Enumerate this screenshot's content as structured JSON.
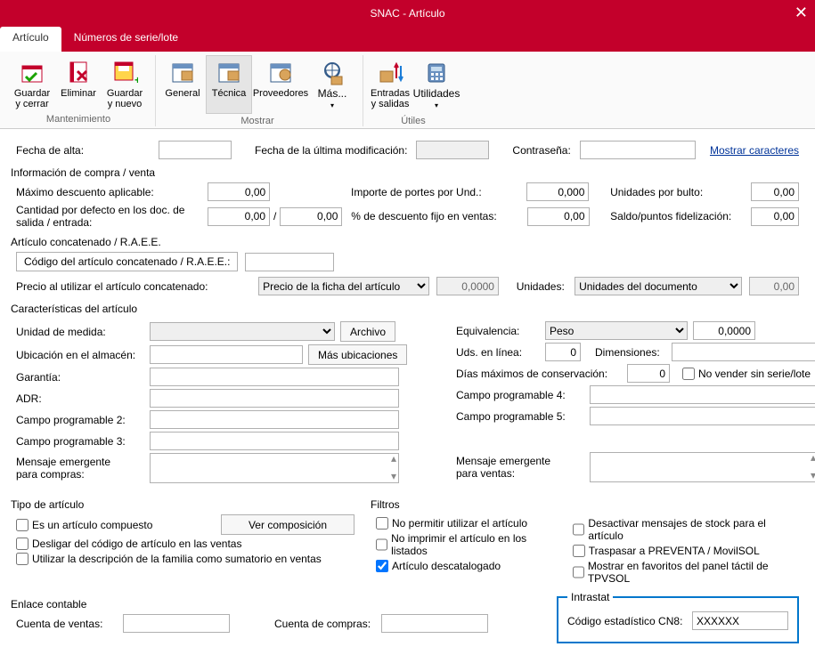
{
  "title": "SNAC - Artículo",
  "tabs": {
    "articulo": "Artículo",
    "series": "Números de serie/lote"
  },
  "ribbon": {
    "groups": {
      "mantenimiento": "Mantenimiento",
      "mostrar": "Mostrar",
      "utiles": "Útiles",
      "u2": ""
    },
    "buttons": {
      "guardar_cerrar": "Guardar\ny cerrar",
      "eliminar": "Eliminar",
      "guardar_nuevo": "Guardar\ny nuevo",
      "general": "General",
      "tecnica": "Técnica",
      "proveedores": "Proveedores",
      "mas": "Más...",
      "entradas": "Entradas\ny salidas",
      "utilidades": "Utilidades"
    }
  },
  "labels": {
    "fecha_alta": "Fecha de alta:",
    "fecha_mod": "Fecha de la última modificación:",
    "contrasena": "Contraseña:",
    "mostrar_chars": "Mostrar caracteres",
    "info_compra": "Información de compra / venta",
    "max_desc": "Máximo descuento aplicable:",
    "cant_def": "Cantidad por defecto en los doc. de salida / entrada:",
    "importe_portes": "Importe de portes por Und.:",
    "pct_desc": "% de descuento fijo en ventas:",
    "und_bulto": "Unidades por bulto:",
    "saldo_pts": "Saldo/puntos fidelización:",
    "art_concat": "Artículo concatenado / R.A.E.E.",
    "cod_concat": "Código del artículo concatenado / R.A.E.E.:",
    "precio_concat": "Precio al utilizar el artículo concatenado:",
    "unidades": "Unidades:",
    "caract": "Características del artículo",
    "unidad_medida": "Unidad de medida:",
    "archivo": "Archivo",
    "ubicacion": "Ubicación en el almacén:",
    "mas_ubic": "Más ubicaciones",
    "garantia": "Garantía:",
    "adr": "ADR:",
    "campo2": "Campo programable 2:",
    "campo3": "Campo programable 3:",
    "msg_compras": "Mensaje emergente\npara compras:",
    "equivalencia": "Equivalencia:",
    "peso": "Peso",
    "uds_linea": "Uds. en línea:",
    "dimensiones": "Dimensiones:",
    "dias_max": "Días máximos de conservación:",
    "no_vender": "No vender sin serie/lote",
    "campo4": "Campo programable 4:",
    "campo5": "Campo programable 5:",
    "msg_ventas": "Mensaje emergente\npara ventas:",
    "tipo_art": "Tipo de artículo",
    "compuesto": "Es un artículo compuesto",
    "ver_comp": "Ver composición",
    "desligar": "Desligar del código de artículo en las ventas",
    "usar_desc": "Utilizar la descripción de la familia como sumatorio en ventas",
    "filtros": "Filtros",
    "no_permitir": "No permitir utilizar el artículo",
    "no_imprimir": "No imprimir el artículo en los listados",
    "descatalogado": "Artículo descatalogado",
    "desactivar_stock": "Desactivar mensajes de stock para el artículo",
    "traspasar": "Traspasar a PREVENTA / MovilSOL",
    "favoritos": "Mostrar en favoritos del panel táctil de TPVSOL",
    "enlace": "Enlace contable",
    "cta_ventas": "Cuenta de ventas:",
    "cta_compras": "Cuenta de compras:",
    "intrastat": "Intrastat",
    "cn8": "Código estadístico CN8:"
  },
  "values": {
    "max_desc": "0,00",
    "cant_def_salida": "0,00",
    "cant_def_entrada": "0,00",
    "importe_portes": "0,000",
    "pct_desc": "0,00",
    "und_bulto": "0,00",
    "saldo_pts": "0,00",
    "precio_concat_sel": "Precio de la ficha del artículo",
    "precio_concat_num": "0,0000",
    "unidades_sel": "Unidades del documento",
    "unidades_num": "0,00",
    "equiv_num": "0,0000",
    "uds_linea": "0",
    "dias_max": "0",
    "cn8": "XXXXXX"
  },
  "state": {
    "descatalogado_checked": true
  }
}
